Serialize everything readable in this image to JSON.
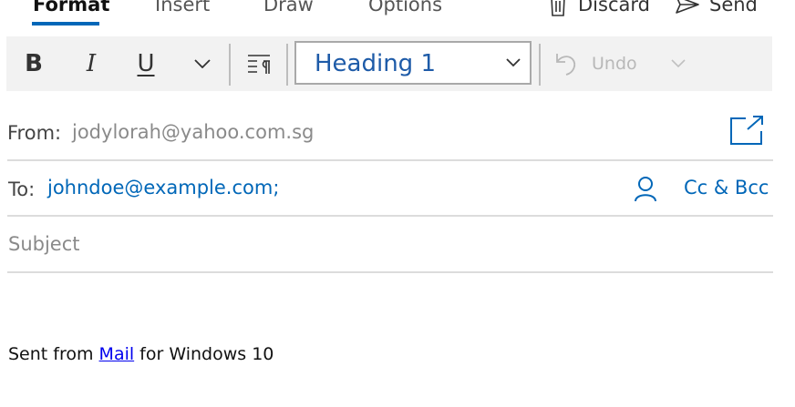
{
  "tabs": [
    {
      "label": "Format",
      "active": true
    },
    {
      "label": "Insert",
      "active": false
    },
    {
      "label": "Draw",
      "active": false
    },
    {
      "label": "Options",
      "active": false
    }
  ],
  "actions": {
    "discard_label": "Discard",
    "send_label": "Send"
  },
  "toolbar": {
    "bold": "B",
    "italic": "I",
    "underline": "U",
    "style_value": "Heading 1",
    "undo_label": "Undo"
  },
  "from": {
    "label": "From:",
    "value": "jodylorah@yahoo.com.sg"
  },
  "to": {
    "label": "To:",
    "value": "johndoe@example.com;",
    "cc_bcc_label": "Cc & Bcc"
  },
  "subject": {
    "placeholder": "Subject"
  },
  "body": {
    "prefix": "Sent from ",
    "link": "Mail",
    "suffix": " for Windows 10"
  },
  "colors": {
    "accent": "#0067b8",
    "toolbar_bg": "#f2f2f2",
    "style_text": "#1e5ba8"
  },
  "icons": [
    "discard-icon",
    "send-icon",
    "chevron-down-icon",
    "paragraph-icon",
    "undo-icon",
    "popout-icon",
    "person-icon"
  ]
}
